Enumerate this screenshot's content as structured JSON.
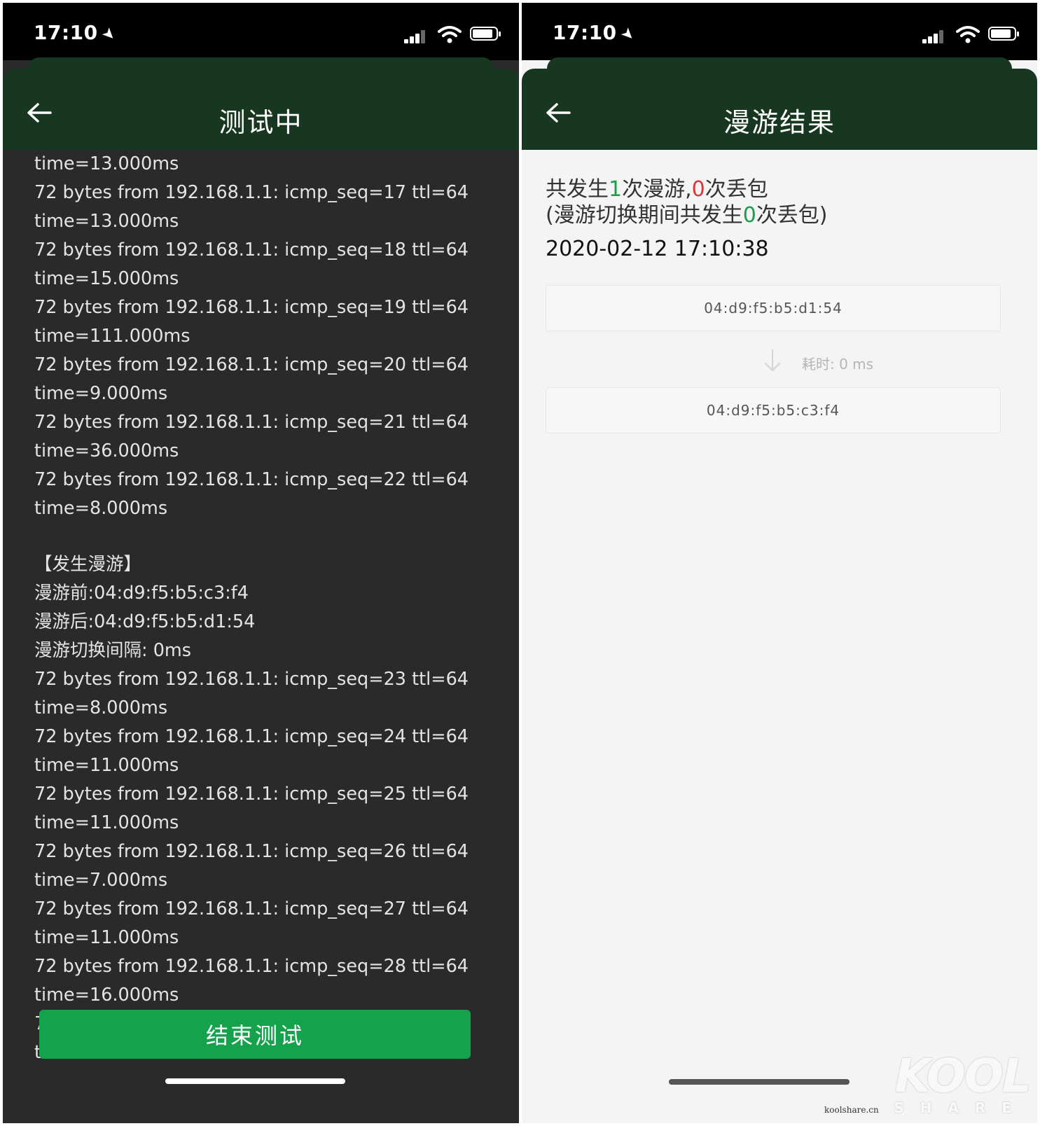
{
  "left_screen": {
    "status_bar": {
      "time": "17:10"
    },
    "title": "测试中",
    "log_lines": [
      "time=13.000ms",
      "72 bytes from 192.168.1.1: icmp_seq=17 ttl=64",
      "time=13.000ms",
      "72 bytes from 192.168.1.1: icmp_seq=18 ttl=64",
      "time=15.000ms",
      "72 bytes from 192.168.1.1: icmp_seq=19 ttl=64",
      "time=111.000ms",
      "72 bytes from 192.168.1.1: icmp_seq=20 ttl=64",
      "time=9.000ms",
      "72 bytes from 192.168.1.1: icmp_seq=21 ttl=64",
      "time=36.000ms",
      "72 bytes from 192.168.1.1: icmp_seq=22 ttl=64",
      "time=8.000ms",
      "",
      "【发生漫游】",
      "漫游前:04:d9:f5:b5:c3:f4",
      "漫游后:04:d9:f5:b5:d1:54",
      "漫游切换间隔: 0ms",
      "72 bytes from 192.168.1.1: icmp_seq=23 ttl=64",
      "time=8.000ms",
      "72 bytes from 192.168.1.1: icmp_seq=24 ttl=64",
      "time=11.000ms",
      "72 bytes from 192.168.1.1: icmp_seq=25 ttl=64",
      "time=11.000ms",
      "72 bytes from 192.168.1.1: icmp_seq=26 ttl=64",
      "time=7.000ms",
      "72 bytes from 192.168.1.1: icmp_seq=27 ttl=64",
      "time=11.000ms",
      "72 bytes from 192.168.1.1: icmp_seq=28 ttl=64",
      "time=16.000ms",
      "72 bytes from 192.168.1.1: icmp_seq=29 ttl=64",
      "t"
    ],
    "end_button_label": "结束测试"
  },
  "right_screen": {
    "status_bar": {
      "time": "17:10"
    },
    "title": "漫游结果",
    "summary": {
      "part1": "共发生",
      "roam_count": "1",
      "part2": "次漫游,",
      "loss_count": "0",
      "part3": "次丢包",
      "part4": "(漫游切换期间共发生",
      "switch_loss_count": "0",
      "part5": "次丢包)"
    },
    "datetime": "2020-02-12 17:10:38",
    "mac_from": "04:d9:f5:b5:d1:54",
    "elapsed_label": "耗时: 0 ms",
    "mac_to": "04:d9:f5:b5:c3:f4"
  },
  "watermark": {
    "logo": "KOOL",
    "sub": "SHARE",
    "site": "koolshare.cn"
  },
  "colors": {
    "nav_green": "#173720",
    "button_green": "#15a24c",
    "count_green": "#1a9e4a",
    "count_red": "#d5383a",
    "log_bg": "#2a2a2a"
  }
}
